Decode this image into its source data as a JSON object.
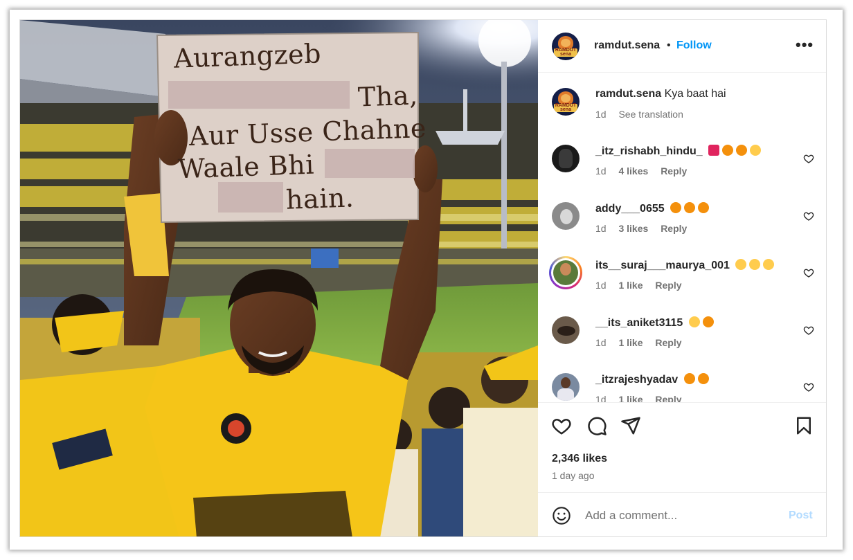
{
  "post": {
    "author": "ramdut.sena",
    "follow_label": "Follow",
    "more_label": "•••",
    "separator": "•"
  },
  "photo": {
    "sign_lines": [
      "Aurangzeb",
      "Tha,",
      "Aur Usse Chahne",
      "Waale Bhi",
      "hain."
    ]
  },
  "avatar_logo_text": "RAMDUT sena",
  "caption": {
    "username": "ramdut.sena",
    "text": "Kya baat hai",
    "time": "1d",
    "see_translation": "See translation"
  },
  "comments": [
    {
      "username": "_itz_rishabh_hindu_",
      "emojis": [
        "❤️",
        "🔥",
        "🔥",
        "👏"
      ],
      "time": "1d",
      "likes": "4 likes",
      "reply": "Reply"
    },
    {
      "username": "addy___0655",
      "emojis": [
        "🔥",
        "🔥",
        "🔥"
      ],
      "time": "1d",
      "likes": "3 likes",
      "reply": "Reply"
    },
    {
      "username": "its__suraj___maurya_001",
      "emojis": [
        "😂",
        "😂",
        "😂"
      ],
      "time": "1d",
      "likes": "1 like",
      "reply": "Reply"
    },
    {
      "username": "__its_aniket3115",
      "emojis": [
        "😂",
        "🔥"
      ],
      "time": "1d",
      "likes": "1 like",
      "reply": "Reply"
    },
    {
      "username": "_itzrajeshyadav",
      "emojis": [
        "🔥",
        "🔥"
      ],
      "time": "1d",
      "likes": "1 like",
      "reply": "Reply"
    }
  ],
  "stats": {
    "likes": "2,346 likes",
    "ago": "1 day ago"
  },
  "add_comment": {
    "placeholder": "Add a comment...",
    "post_label": "Post"
  },
  "colors": {
    "accent": "#0095f6",
    "post_disabled": "#b3dbff",
    "like_red": "#ff3040",
    "jersey_yellow": "#f5c518"
  },
  "icons": {
    "like": "heart-icon",
    "comment": "comment-icon",
    "share": "send-icon",
    "save": "bookmark-icon",
    "emoji": "smile-icon",
    "more": "more-options-icon"
  }
}
